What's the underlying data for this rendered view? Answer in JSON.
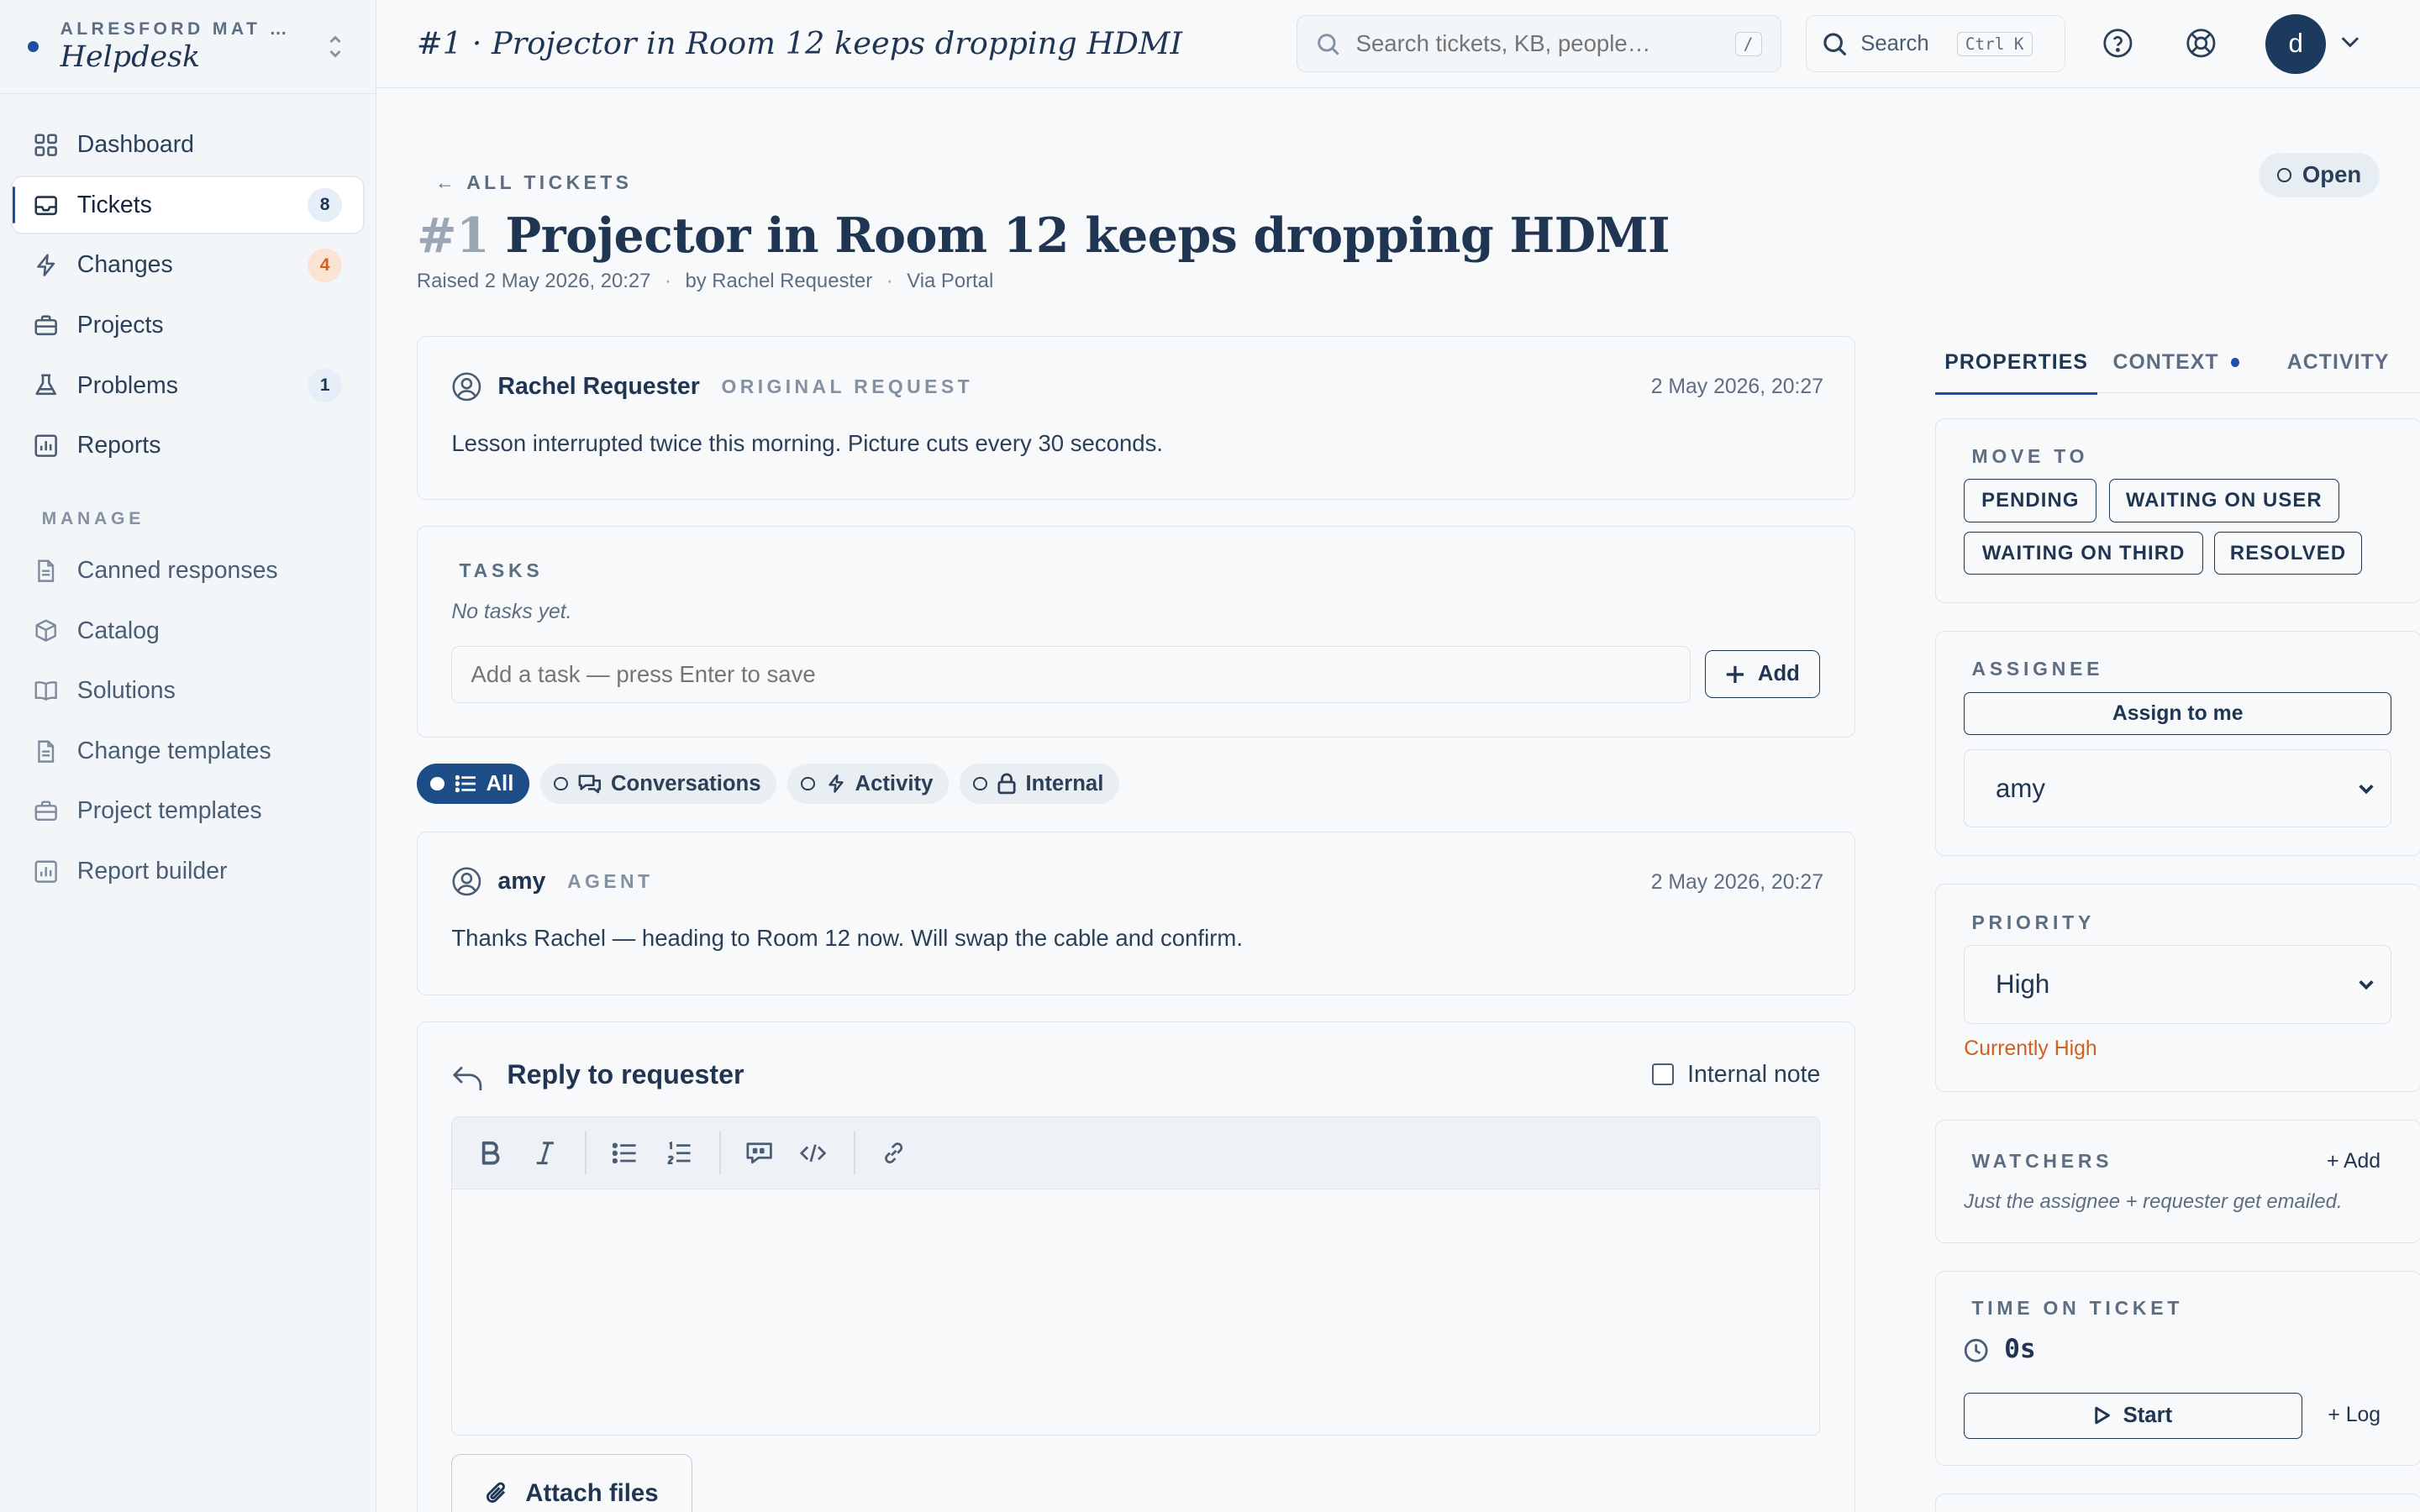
{
  "org": {
    "name": "ALRESFORD MAT …",
    "app": "Helpdesk"
  },
  "nav": {
    "items": [
      {
        "label": "Dashboard",
        "icon": "grid-icon"
      },
      {
        "label": "Tickets",
        "icon": "inbox-icon",
        "badge": "8"
      },
      {
        "label": "Changes",
        "icon": "bolt-icon",
        "badge": "4"
      },
      {
        "label": "Projects",
        "icon": "briefcase-icon"
      },
      {
        "label": "Problems",
        "icon": "flask-icon",
        "badge": "1"
      },
      {
        "label": "Reports",
        "icon": "bar-chart-icon"
      }
    ],
    "manage_label": "MANAGE",
    "manage_items": [
      {
        "label": "Canned responses",
        "icon": "document-icon"
      },
      {
        "label": "Catalog",
        "icon": "cube-icon"
      },
      {
        "label": "Solutions",
        "icon": "book-icon"
      },
      {
        "label": "Change templates",
        "icon": "document-icon"
      },
      {
        "label": "Project templates",
        "icon": "briefcase-icon"
      },
      {
        "label": "Report builder",
        "icon": "bar-chart-icon"
      }
    ]
  },
  "topbar": {
    "title": "#1 · Projector in Room 12 keeps dropping HDMI",
    "search_placeholder": "Search tickets, KB, people…",
    "search_shortcut": "/",
    "search_button": "Search",
    "search_button_shortcut": "Ctrl K",
    "avatar_initial": "d"
  },
  "ticket": {
    "back_label": "← ALL TICKETS",
    "status": "Open",
    "number": "#1",
    "title": "Projector in Room 12 keeps dropping HDMI",
    "raised": "Raised 2 May 2026, 20:27",
    "by": "by Rachel Requester",
    "via": "Via Portal"
  },
  "original": {
    "author": "Rachel Requester",
    "role": "ORIGINAL REQUEST",
    "time": "2 May 2026, 20:27",
    "body": "Lesson interrupted twice this morning. Picture cuts every 30 seconds."
  },
  "tasks": {
    "label": "TASKS",
    "empty": "No tasks yet.",
    "placeholder": "Add a task — press Enter to save",
    "add_label": "Add"
  },
  "filters": [
    {
      "label": "All",
      "active": true
    },
    {
      "label": "Conversations"
    },
    {
      "label": "Activity"
    },
    {
      "label": "Internal"
    }
  ],
  "comment": {
    "author": "amy",
    "role": "AGENT",
    "time": "2 May 2026, 20:27",
    "body": "Thanks Rachel — heading to Room 12 now. Will swap the cable and confirm."
  },
  "reply": {
    "title": "Reply to requester",
    "internal_note": "Internal note",
    "attach_label": "Attach files"
  },
  "panel": {
    "tabs": [
      {
        "label": "PROPERTIES"
      },
      {
        "label": "CONTEXT"
      },
      {
        "label": "ACTIVITY"
      }
    ],
    "move_to_label": "MOVE TO",
    "move_to": [
      "PENDING",
      "WAITING ON USER",
      "WAITING ON THIRD",
      "RESOLVED"
    ],
    "assignee_label": "ASSIGNEE",
    "assign_me": "Assign to me",
    "assignee_value": "amy",
    "priority_label": "PRIORITY",
    "priority_value": "High",
    "priority_note": "Currently High",
    "watchers_label": "WATCHERS",
    "watchers_add": "+ Add",
    "watchers_note": "Just the assignee + requester get emailed.",
    "time_label": "TIME ON TICKET",
    "time_value": "0s",
    "start_label": "Start",
    "log_label": "+ Log"
  },
  "colors": {
    "accent": "#1e4fa3",
    "navy": "#1c3a5e",
    "warning": "#d0601e"
  }
}
